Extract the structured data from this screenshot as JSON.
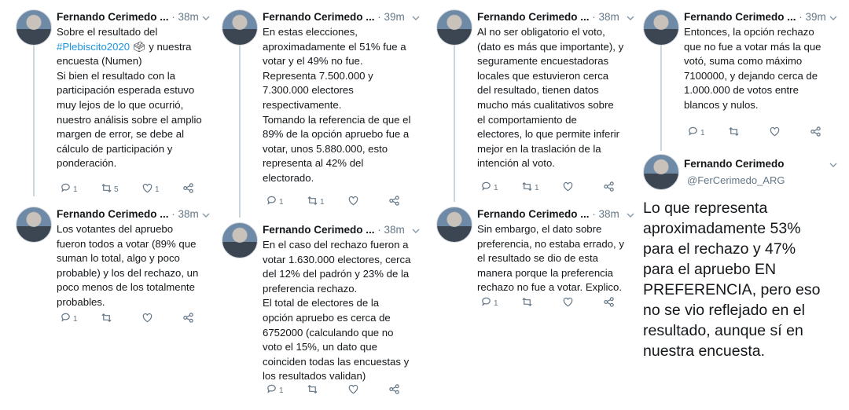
{
  "author_name": "Fernando Cerimedo ...",
  "author_full": "Fernando Cerimedo",
  "handle": "@FerCerimedo_ARG",
  "columns": [
    [
      {
        "time": "· 38m",
        "parts": [
          "Sobre el resultado del\n",
          "#Plebiscito2020",
          "🗳 y nuestra\nencuesta (Numen)\nSi bien el resultado con la\nparticipación esperada estuvo\nmuy lejos de lo que ocurrió,\nnuestro análisis sobre el amplio\nmargen de error, se debe al\ncálculo de participación y\nponderación."
        ],
        "counts": [
          "1",
          "5",
          "1",
          ""
        ]
      },
      {
        "time": "· 38m",
        "parts": [
          "Los votantes del apruebo\nfueron todos a votar (89% que\nsuman lo total, algo y poco\nprobable) y los del rechazo, un\npoco menos de los totalmente\nprobables."
        ],
        "counts": [
          "1",
          "",
          "",
          ""
        ]
      }
    ],
    [
      {
        "time": "· 39m",
        "parts": [
          "En estas elecciones,\naproximadamente el 51% fue a\nvotar y el 49% no fue.\nRepresenta 7.500.000 y\n7.300.000 electores\nrespectivamente.\nTomando la referencia de que el\n89% de la opción apruebo fue a\nvotar, unos 5.880.000, esto\nrepresenta al 42% del\nelectorado."
        ],
        "counts": [
          "1",
          "1",
          "",
          ""
        ]
      },
      {
        "time": "· 38m",
        "parts": [
          "En el caso del rechazo fueron a\nvotar 1.630.000 electores, cerca\ndel 12% del padrón y 23% de la\npreferencia rechazo.\nEl total de electores de la\nopción apruebo es cerca de\n6752000 (calculando que no\nvoto el 15%, un dato que\ncoinciden todas las encuestas y\nlos resultados validan)"
        ],
        "counts": [
          "1",
          "",
          "",
          ""
        ]
      }
    ],
    [
      {
        "time": "· 38m",
        "parts": [
          "Al no ser obligatorio el voto,\n(dato es más que importante), y\nseguramente encuestadoras\nlocales  que estuvieron cerca\ndel resultado, tienen datos\nmucho más cualitativos sobre\nel comportamiento de\nelectores, lo que permite inferir\nmejor en la traslación de la\nintención al voto."
        ],
        "counts": [
          "1",
          "1",
          "",
          ""
        ]
      },
      {
        "time": "· 38m",
        "parts": [
          "Sin embargo, el dato sobre\npreferencia, no estaba errado, y\nel resultado se dio de esta\nmanera porque la preferencia\nrechazo no fue a votar. Explico."
        ],
        "counts": [
          "1",
          "",
          "",
          ""
        ]
      }
    ],
    [
      {
        "time": "· 39m",
        "parts": [
          "Entonces, la opción rechazo\nque no fue a votar más la que\nvotó, suma como máximo\n7100000, y dejando cerca de\n1.000.000 de votos entre\nblancos y nulos."
        ],
        "counts": [
          "1",
          "",
          "",
          ""
        ]
      }
    ]
  ],
  "final_text": "Lo que representa\naproximadamente 53%\npara el rechazo y 47%\npara el apruebo EN\nPREFERENCIA, pero eso\nno se vio reflejado en el\nresultado, aunque sí en\nnuestra encuesta."
}
